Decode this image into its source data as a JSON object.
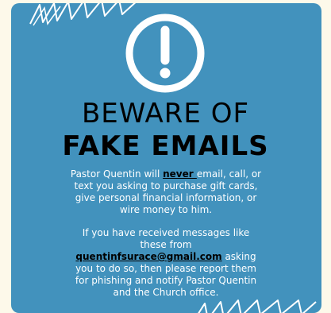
{
  "headline": {
    "line1": "BEWARE OF",
    "line2": "FAKE EMAILS"
  },
  "paragraph1": {
    "before": "Pastor Quentin will ",
    "emphasis": "never ",
    "after": "email, call, or text you asking to purchase gift cards, give personal financial information, or wire money to him."
  },
  "paragraph2": {
    "before": "If you have received messages like these from ",
    "email": "quentinfsurace@gmail.com",
    "after": " asking you to do so, then please report them for phishing and notify Pastor Quentin and the Church office."
  },
  "colors": {
    "background": "#fdf9ea",
    "card": "#4292bd",
    "icon": "#ffffff",
    "headline": "#000000",
    "body_text": "#ffffff"
  },
  "icons": {
    "alert": "exclamation-circle-icon",
    "top_decoration": "zigzag-scribble-decoration",
    "bottom_decoration": "zigzag-scribble-decoration"
  }
}
